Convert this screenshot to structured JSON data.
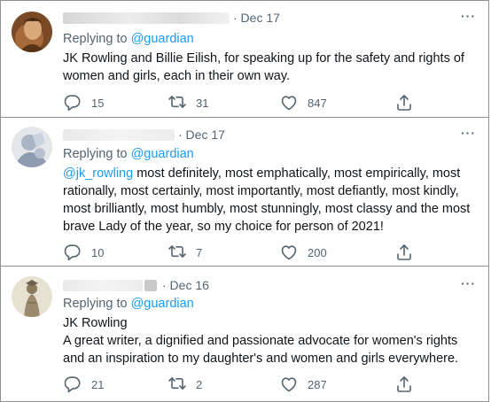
{
  "tweets": [
    {
      "date": "· Dec 17",
      "replying_to": "Replying to",
      "handle": "@guardian",
      "body": "JK Rowling and Billie Eilish, for speaking up for the safety and rights of women and girls, each in their own way.",
      "replies": "15",
      "retweets": "31",
      "likes": "847"
    },
    {
      "date": "· Dec 17",
      "replying_to": "Replying to",
      "handle": "@guardian",
      "mention": "@jk_rowling",
      "body": " most definitely, most emphatically, most empirically, most rationally, most certainly, most importantly, most defiantly, most kindly, most brilliantly, most humbly, most stunningly, most classy and the most brave Lady of the year, so my choice for person of 2021!",
      "replies": "10",
      "retweets": "7",
      "likes": "200"
    },
    {
      "date": "· Dec 16",
      "replying_to": "Replying to",
      "handle": "@guardian",
      "title_line": "JK Rowling",
      "body": "A great writer, a dignified and passionate advocate for women's rights and an inspiration to my daughter's and women and girls everywhere.",
      "replies": "21",
      "retweets": "2",
      "likes": "287"
    }
  ],
  "icons": {
    "reply": "reply-icon",
    "retweet": "retweet-icon",
    "like": "heart-icon",
    "share": "share-icon",
    "more": "more-options-icon"
  },
  "colors": {
    "link": "#1d9bf0",
    "muted": "#536471",
    "text": "#0f1419"
  }
}
